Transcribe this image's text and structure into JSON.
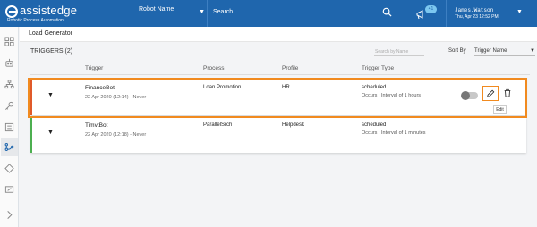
{
  "header": {
    "brand": "assistedge",
    "brand_tagline": "Robotic Process Automation",
    "robot_select": "Robot Name",
    "search_label": "Search",
    "notification_count": "41",
    "user_name": "James.Watson",
    "user_datetime": "Thu, Apr 23 12:52 PM"
  },
  "page": {
    "title": "Load Generator",
    "triggers_count": "TRIGGERS (2)",
    "search_placeholder": "Search by Name",
    "sort_by_label": "Sort By",
    "sort_value": "Trigger Name"
  },
  "columns": [
    "Trigger",
    "Process",
    "Profile",
    "Trigger Type"
  ],
  "triggers": [
    {
      "name": "FinanceBot",
      "created": "22 Apr 2020 (12:14) - Never",
      "process": "Loan Promotion",
      "profile": "HR",
      "type": "scheduled",
      "occurs": "Occurs : Interval of 1 hours",
      "status_color": "#e05a2a"
    },
    {
      "name": "TimvtBot",
      "created": "22 Apr 2020 (12:18) - Never",
      "process": "ParallelSrch",
      "profile": "Helpdesk",
      "type": "scheduled",
      "occurs": "Occurs : Interval of 1 minutes",
      "status_color": "#4caf50"
    }
  ],
  "tooltip": "Edit",
  "icons": {
    "sidebar": [
      "grid-icon",
      "robot-icon",
      "hierarchy-icon",
      "key-icon",
      "list-icon",
      "workflow-icon",
      "diamond-icon",
      "monitor-icon",
      "chevron-right-icon"
    ],
    "row_actions": [
      "toggle",
      "edit-icon",
      "delete-icon"
    ]
  },
  "colors": {
    "header_bg": "#1f66ad",
    "highlight": "#f18a1f"
  }
}
